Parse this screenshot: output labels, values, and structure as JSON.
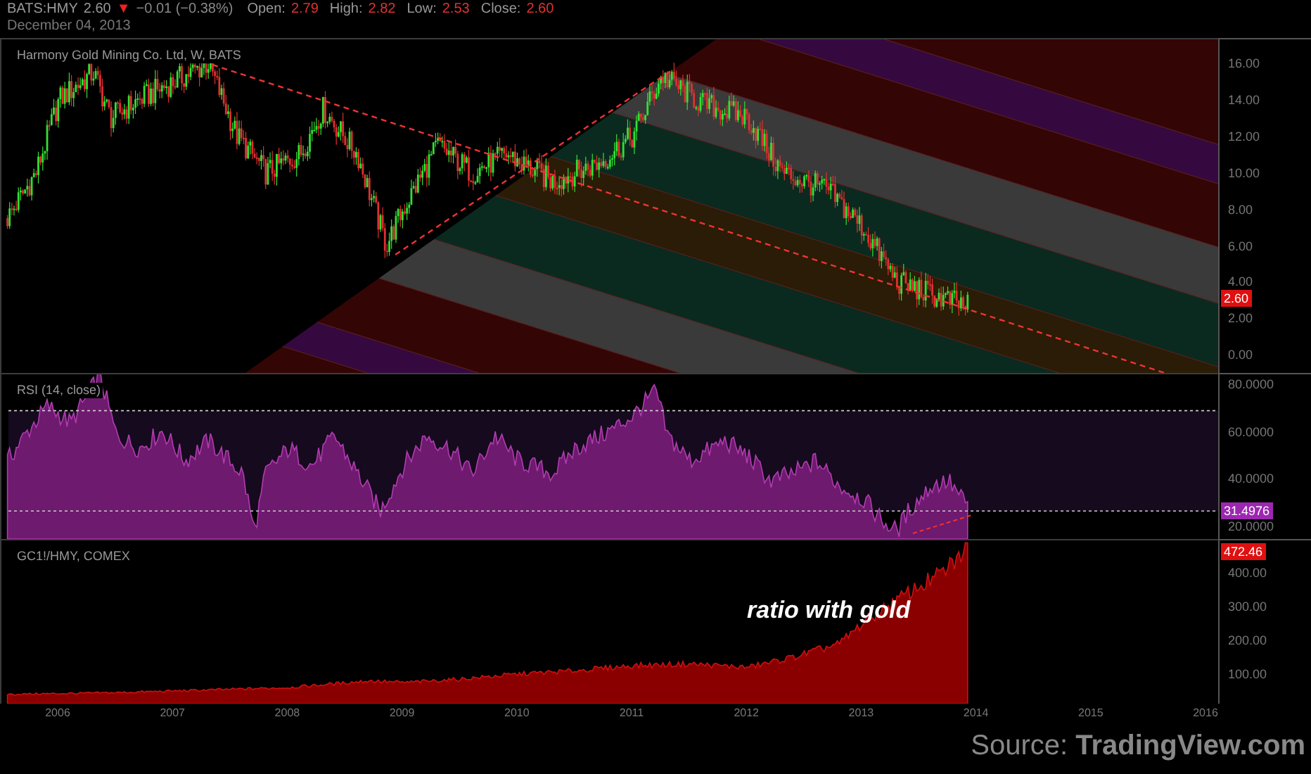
{
  "header": {
    "symbol": "BATS:HMY",
    "price": "2.60",
    "direction": "▼",
    "change": "−0.01 (−0.38%)",
    "ohlc": [
      {
        "label": "Open:",
        "value": "2.79"
      },
      {
        "label": "High:",
        "value": "2.82"
      },
      {
        "label": "Low:",
        "value": "2.53"
      },
      {
        "label": "Close:",
        "value": "2.60"
      }
    ],
    "date": "December 04, 2013"
  },
  "panes": [
    {
      "kind": "price",
      "legend": "Harmony Gold Mining Co. Ltd, W, BATS",
      "axis_labels": [
        "16.00",
        "14.00",
        "12.00",
        "10.00",
        "8.00",
        "6.00",
        "4.00",
        "2.00",
        "0.00"
      ],
      "last_value": "2.60"
    },
    {
      "kind": "rsi",
      "legend": "RSI (14, close)",
      "axis_labels": [
        "80.0000",
        "60.0000",
        "40.0000",
        "20.0000"
      ],
      "last_value": "31.4976"
    },
    {
      "kind": "ratio",
      "legend": "GC1!/HMY, COMEX",
      "axis_labels": [
        "400.00",
        "300.00",
        "200.00",
        "100.00"
      ],
      "last_value": "472.46",
      "annotation": "ratio with gold"
    }
  ],
  "x_axis": [
    "2006",
    "2007",
    "2008",
    "2009",
    "2010",
    "2011",
    "2012",
    "2013",
    "2014",
    "2015",
    "2016"
  ],
  "source": "Source: **TradingView.com**"
}
